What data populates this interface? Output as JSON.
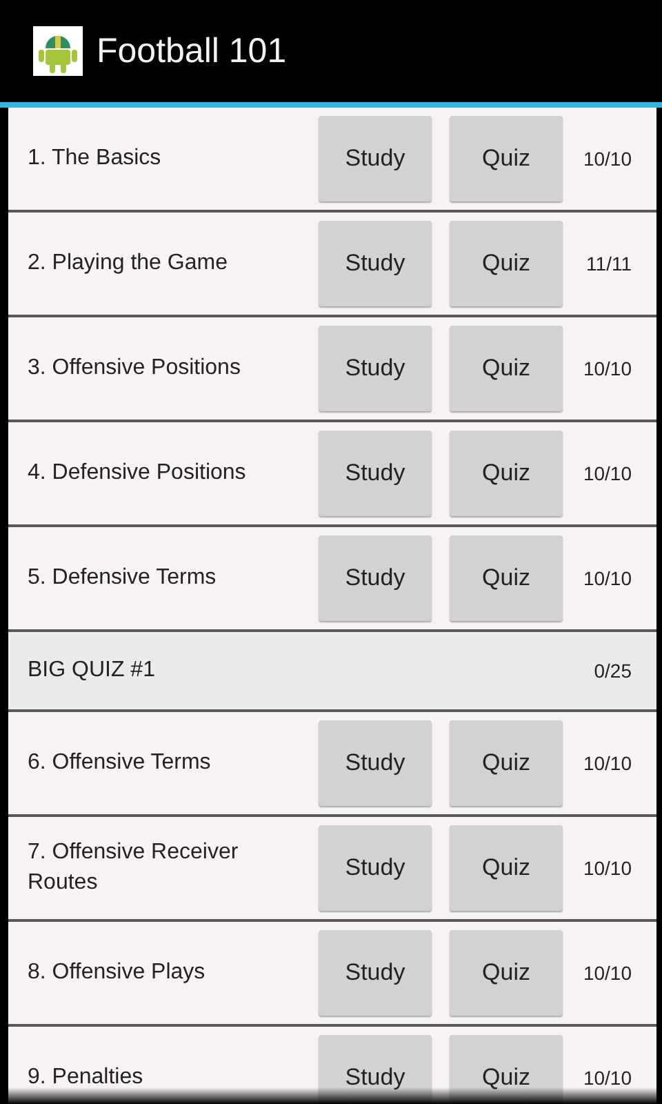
{
  "app_bar": {
    "title": "Football 101"
  },
  "rows": [
    {
      "kind": "lesson",
      "title": "1. The Basics",
      "study": "Study",
      "quiz": "Quiz",
      "score": "10/10"
    },
    {
      "kind": "lesson",
      "title": "2. Playing the Game",
      "study": "Study",
      "quiz": "Quiz",
      "score": "11/11"
    },
    {
      "kind": "lesson",
      "title": "3. Offensive Positions",
      "study": "Study",
      "quiz": "Quiz",
      "score": "10/10"
    },
    {
      "kind": "lesson",
      "title": "4. Defensive Positions",
      "study": "Study",
      "quiz": "Quiz",
      "score": "10/10"
    },
    {
      "kind": "lesson",
      "title": "5. Defensive Terms",
      "study": "Study",
      "quiz": "Quiz",
      "score": "10/10"
    },
    {
      "kind": "big_quiz",
      "title": "BIG QUIZ #1",
      "score": "0/25"
    },
    {
      "kind": "lesson",
      "title": "6. Offensive Terms",
      "study": "Study",
      "quiz": "Quiz",
      "score": "10/10"
    },
    {
      "kind": "lesson",
      "title": "7. Offensive Receiver Routes",
      "study": "Study",
      "quiz": "Quiz",
      "score": "10/10"
    },
    {
      "kind": "lesson",
      "title": "8. Offensive Plays",
      "study": "Study",
      "quiz": "Quiz",
      "score": "10/10"
    },
    {
      "kind": "lesson",
      "title": "9. Penalties",
      "study": "Study",
      "quiz": "Quiz",
      "score": "10/10"
    }
  ]
}
